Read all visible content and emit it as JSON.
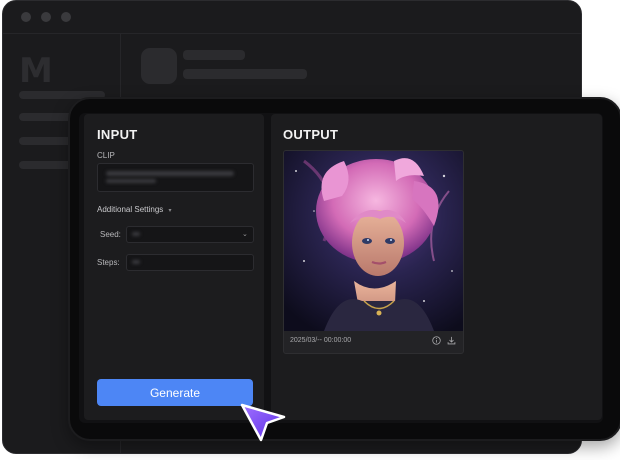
{
  "input_panel": {
    "title": "INPUT",
    "clip_label": "CLIP",
    "additional_settings_label": "Additional Settings",
    "seed_label": "Seed:",
    "steps_label": "Steps:",
    "generate_label": "Generate"
  },
  "output_panel": {
    "title": "OUTPUT",
    "timestamp": "2025/03/-- 00:00:00"
  },
  "bg_logo": "M",
  "icons": [
    "chevron-down-icon",
    "info-icon",
    "download-icon",
    "pointer-cursor-icon"
  ],
  "colors": {
    "accent": "#4d86f5",
    "cursor": "#7c4dff",
    "panel": "#1c1c1e",
    "background_window": "#1b1b1d"
  }
}
